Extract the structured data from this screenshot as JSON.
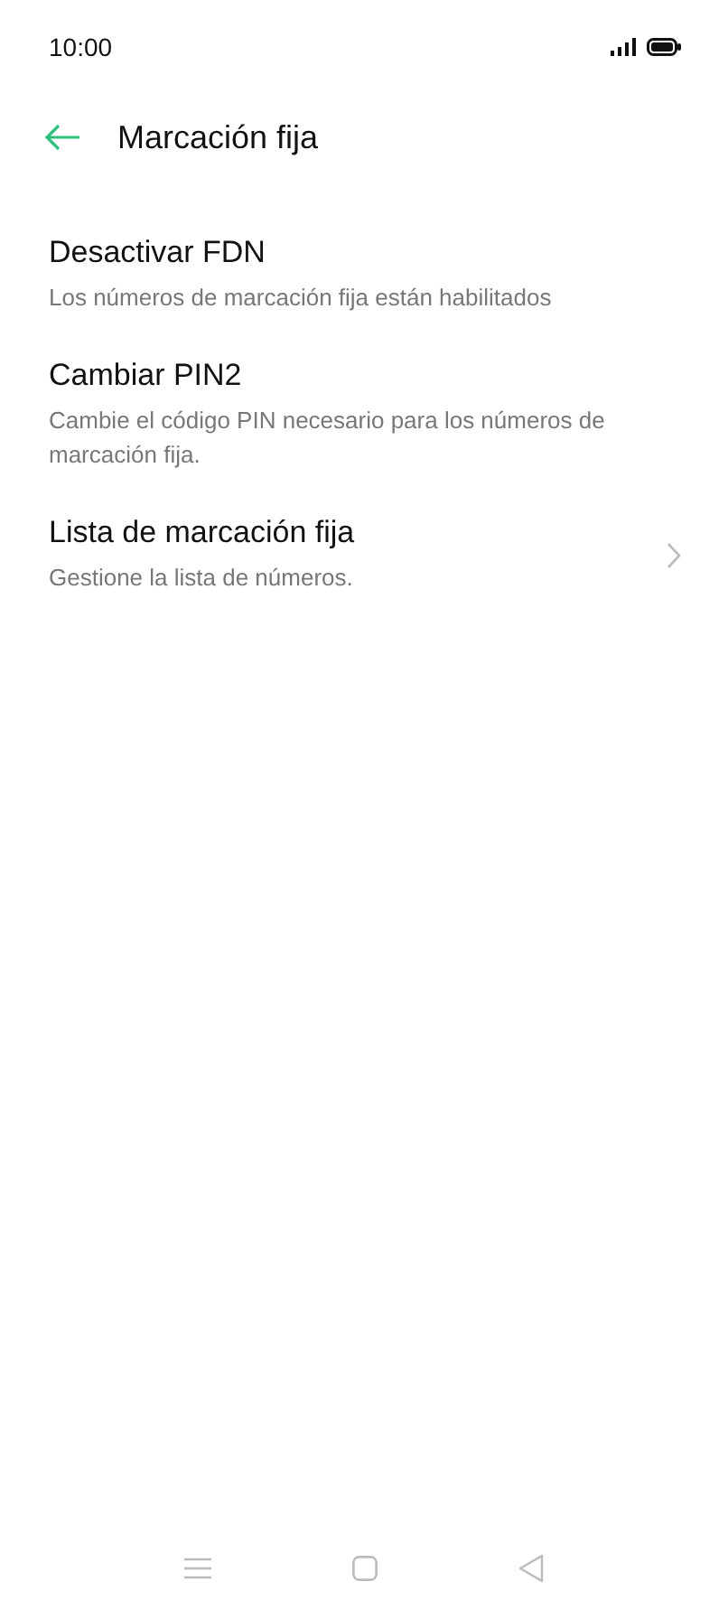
{
  "status_bar": {
    "time": "10:00"
  },
  "header": {
    "title": "Marcación fija"
  },
  "items": [
    {
      "kind": "plain",
      "title": "Desactivar FDN",
      "subtitle": "Los números de marcación fija están habilitados"
    },
    {
      "kind": "plain",
      "title": "Cambiar PIN2",
      "subtitle": "Cambie el código PIN necesario para los números de marcación fija."
    },
    {
      "kind": "link",
      "title": "Lista de marcación fija",
      "subtitle": "Gestione la lista de números."
    }
  ]
}
